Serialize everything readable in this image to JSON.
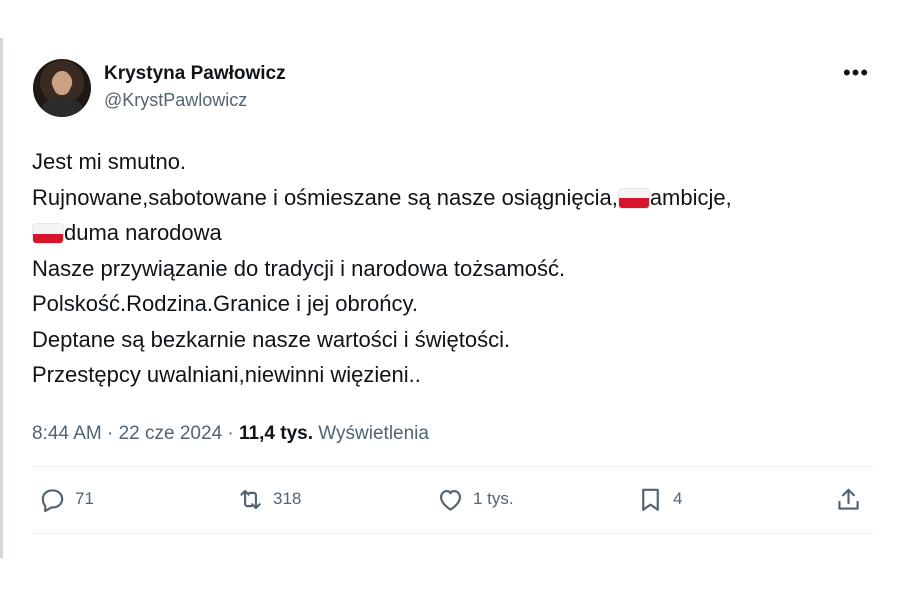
{
  "author": {
    "display_name": "Krystyna Pawłowicz",
    "handle": "@KrystPawlowicz"
  },
  "tweet": {
    "line1": "Jest mi smutno.",
    "line2a": "Rujnowane,sabotowane i ośmieszane są nasze osiągnięcia,",
    "line2b": "ambicje,",
    "line3": "duma narodowa",
    "line4": "Nasze przywiązanie do tradycji i narodowa tożsamość.",
    "line5": "Polskość.Rodzina.Granice i jej obrońcy.",
    "line6": "Deptane są bezkarnie nasze wartości i świętości.",
    "line7": "Przestępcy uwalniani,niewinni więzieni.."
  },
  "meta": {
    "time": "8:44 AM",
    "sep1": " · ",
    "date": "22 cze 2024",
    "sep2": " · ",
    "views_count": "11,4 tys.",
    "views_label": " Wyświetlenia"
  },
  "actions": {
    "replies": "71",
    "reposts": "318",
    "likes": "1 tys.",
    "bookmarks": "4"
  },
  "colors": {
    "text": "#0f1419",
    "secondary": "#536471",
    "flag_red": "#d9152d"
  },
  "icons": [
    "more-icon",
    "reply-icon",
    "repost-icon",
    "like-icon",
    "bookmark-icon",
    "share-icon",
    "flag-pl-icon"
  ]
}
